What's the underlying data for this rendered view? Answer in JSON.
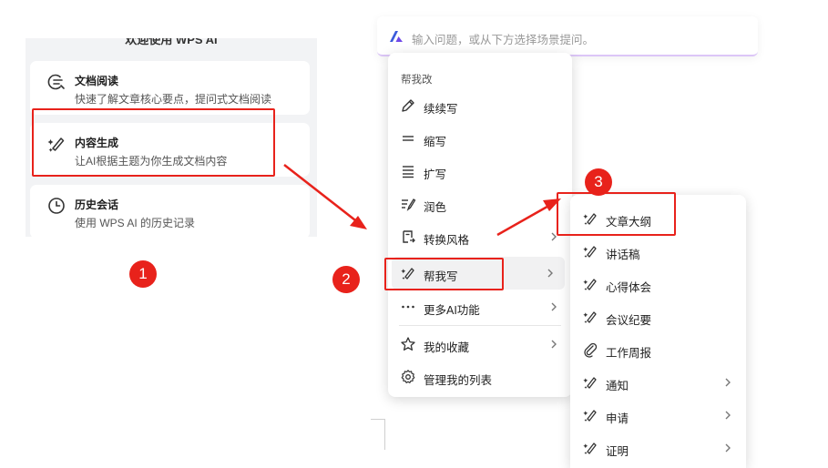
{
  "left_panel": {
    "welcome": "欢迎使用 WPS AI",
    "cards": [
      {
        "title": "文档阅读",
        "desc": "快速了解文章核心要点，提问式文档阅读",
        "icon": "doc-read-icon"
      },
      {
        "title": "内容生成",
        "desc": "让AI根据主题为你生成文档内容",
        "icon": "magic-pen-icon"
      },
      {
        "title": "历史会话",
        "desc": "使用 WPS AI 的历史记录",
        "icon": "clock-icon"
      }
    ]
  },
  "input_bar": {
    "placeholder": "输入问题，或从下方选择场景提问。",
    "logo": "wps-ai-logo-icon"
  },
  "menu1": {
    "section_label": "帮我改",
    "items": [
      {
        "label": "续续写",
        "icon": "pencil-icon",
        "submenu": false
      },
      {
        "label": "缩写",
        "icon": "shorten-icon",
        "submenu": false
      },
      {
        "label": "扩写",
        "icon": "expand-icon",
        "submenu": false
      },
      {
        "label": "润色",
        "icon": "polish-icon",
        "submenu": false
      },
      {
        "label": "转换风格",
        "icon": "convert-style-icon",
        "submenu": true
      },
      {
        "label": "帮我写",
        "icon": "magic-pen-icon",
        "submenu": true
      },
      {
        "label": "更多AI功能",
        "icon": "more-dots-icon",
        "submenu": true
      },
      {
        "label": "我的收藏",
        "icon": "star-icon",
        "submenu": true
      },
      {
        "label": "管理我的列表",
        "icon": "gear-icon",
        "submenu": false
      }
    ]
  },
  "menu2": {
    "items": [
      {
        "label": "文章大纲",
        "icon": "magic-pen-icon",
        "submenu": false
      },
      {
        "label": "讲话稿",
        "icon": "magic-pen-icon",
        "submenu": false
      },
      {
        "label": "心得体会",
        "icon": "magic-pen-icon",
        "submenu": false
      },
      {
        "label": "会议纪要",
        "icon": "magic-pen-icon",
        "submenu": false
      },
      {
        "label": "工作周报",
        "icon": "paperclip-icon",
        "submenu": false
      },
      {
        "label": "通知",
        "icon": "magic-pen-icon",
        "submenu": true
      },
      {
        "label": "申请",
        "icon": "magic-pen-icon",
        "submenu": true
      },
      {
        "label": "证明",
        "icon": "magic-pen-icon",
        "submenu": true
      }
    ]
  },
  "annotations": {
    "step1": "1",
    "step2": "2",
    "step3": "3",
    "color": "#e8221b"
  },
  "colors": {
    "panel_bg": "#f2f3f5",
    "hover_bg": "#f1f1f2",
    "accent_gradient_line": "#dcc6f7"
  }
}
